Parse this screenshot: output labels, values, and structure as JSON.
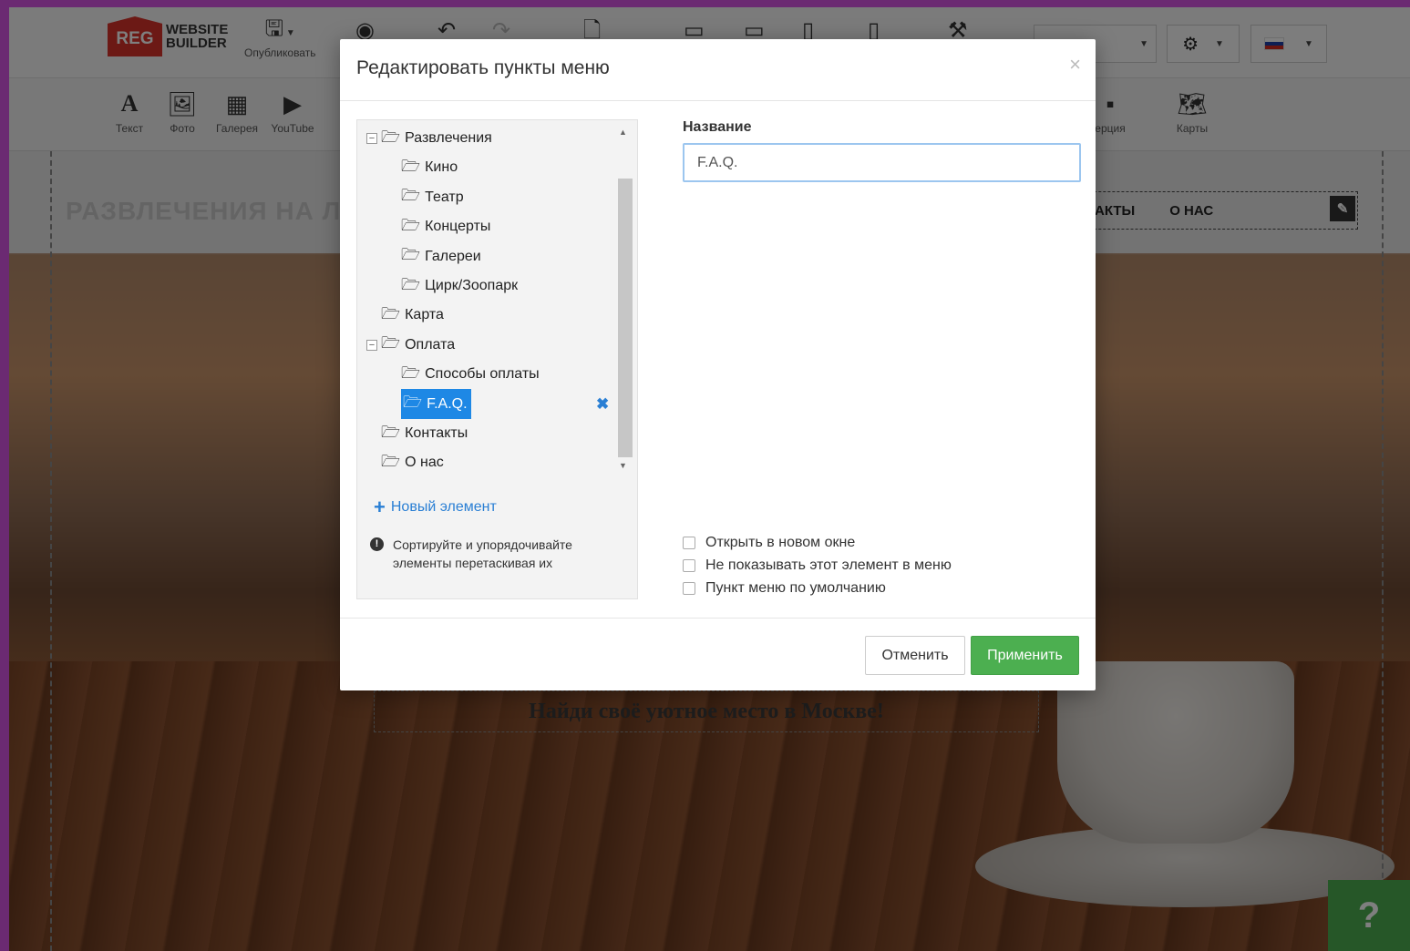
{
  "app": {
    "logo_badge": "REG",
    "logo_line1": "WEBSITE",
    "logo_line2": "BUILDER",
    "publish_label": "Опубликовать",
    "lang_flag_colors": [
      "#ffffff",
      "#1e3fa8",
      "#d52b1e"
    ]
  },
  "toolbar": {
    "tools": [
      {
        "icon": "text-icon",
        "label": "Текст"
      },
      {
        "icon": "photo-icon",
        "label": "Фото"
      },
      {
        "icon": "gallery-icon",
        "label": "Галерея"
      },
      {
        "icon": "youtube-icon",
        "label": "YouTube"
      },
      {
        "icon": "commerce-icon",
        "label": "ерция"
      },
      {
        "icon": "map-icon",
        "label": "Карты"
      }
    ]
  },
  "site": {
    "hero_title": "РАЗВЛЕЧЕНИЯ НА Л",
    "nav_items": [
      "АКТЫ",
      "О НАС"
    ],
    "caption": "Найди своё уютное место в Москве!",
    "help_label": "?"
  },
  "modal": {
    "title": "Редактировать пункты меню",
    "close_symbol": "×",
    "tree": [
      {
        "label": "Развлечения",
        "level": 0,
        "toggle": "−"
      },
      {
        "label": "Кино",
        "level": 1
      },
      {
        "label": "Театр",
        "level": 1
      },
      {
        "label": "Концерты",
        "level": 1
      },
      {
        "label": "Галереи",
        "level": 1
      },
      {
        "label": "Цирк/Зоопарк",
        "level": 1
      },
      {
        "label": "Карта",
        "level": 0
      },
      {
        "label": "Оплата",
        "level": 0,
        "toggle": "−"
      },
      {
        "label": "Способы оплаты",
        "level": 1
      },
      {
        "label": "F.A.Q.",
        "level": 1,
        "selected": true
      },
      {
        "label": "Контакты",
        "level": 0
      },
      {
        "label": "О нас",
        "level": 0
      }
    ],
    "new_item_label": "Новый элемент",
    "hint_text": "Сортируйте и упорядочивайте элементы перетаскивая их",
    "name_label": "Название",
    "name_value": "F.A.Q.",
    "checkboxes": [
      {
        "label": "Открыть в новом окне",
        "checked": false
      },
      {
        "label": "Не показывать этот элемент в меню",
        "checked": false
      },
      {
        "label": "Пункт меню по умолчанию",
        "checked": false
      }
    ],
    "cancel_label": "Отменить",
    "apply_label": "Применить",
    "accent_color": "#1e88e5",
    "apply_color": "#4caf50"
  }
}
